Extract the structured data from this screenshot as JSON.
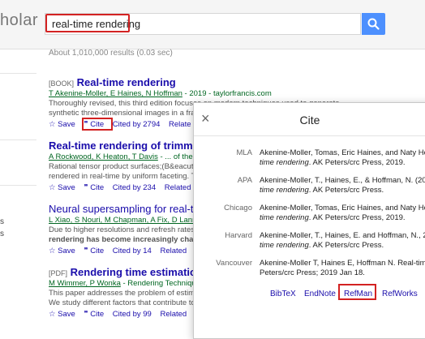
{
  "header": {
    "logo_fragment": "holar",
    "search_value": "real-time rendering"
  },
  "results_summary": "About 1,010,000 results (0.03 sec)",
  "left_panel": {
    "item_1": "s",
    "item_2": "s"
  },
  "results": [
    {
      "tag": "[BOOK]",
      "title": "Real-time rendering",
      "authors_linked": "T Akenine-Moller, E Haines, N Hoffman",
      "authors_rest": " - 2019 - taylorfrancis.com",
      "snippet_1": "Thoroughly revised, this third edition focuses on modern techniques used to generate",
      "snippet_2": "synthetic three-dimensional images in a frac",
      "save": "Save",
      "cite": "Cite",
      "cited_by": "Cited by 2794",
      "related": "Relate"
    },
    {
      "tag": "",
      "title": "Real-time rendering of trimmed s",
      "authors_linked": "A Rockwood, K Heaton, T Davis",
      "authors_rest": " - ... of the 1",
      "snippet_1": "Rational tensor product surfaces;(B&eacute;",
      "snippet_2": "rendered in real-time by uniform faceting. Th",
      "save": "Save",
      "cite": "Cite",
      "cited_by": "Cited by 234",
      "related": "Related"
    },
    {
      "tag": "",
      "title": "Neural supersampling for real-tim",
      "authors_linked": "L Xiao, S Nouri, M Chapman, A Fix, D Lanm",
      "authors_rest": "",
      "snippet_1": "Due to higher resolutions and refresh rates,",
      "snippet_2": "rendering has become increasingly challeng",
      "save": "Save",
      "cite": "Cite",
      "cited_by": "Cited by 14",
      "related": "Related"
    },
    {
      "tag": "[PDF]",
      "title": "Rendering time estimation fo",
      "authors_linked": "M Wimmer, P Wonka",
      "authors_rest": " - Rendering Techniqu",
      "snippet_1": "This paper addresses the problem of estima",
      "snippet_2": "We study different factors that contribute to t",
      "save": "Save",
      "cite": "Cite",
      "cited_by": "Cited by 99",
      "related": "Related"
    }
  ],
  "cite_dialog": {
    "title": "Cite",
    "close": "×",
    "citations": [
      {
        "style": "MLA",
        "line_1": "Akenine-Moller, Tomas, Eric Haines, and Naty Hof",
        "line_2_italic": "time rendering",
        "line_2_rest": ". AK Peters/crc Press, 2019."
      },
      {
        "style": "APA",
        "line_1": "Akenine-Moller, T., Haines, E., & Hoffman, N. (201",
        "line_2_italic": "time rendering",
        "line_2_rest": ". AK Peters/crc Press."
      },
      {
        "style": "Chicago",
        "line_1": "Akenine-Moller, Tomas, Eric Haines, and Naty Hof",
        "line_2_italic": "time rendering",
        "line_2_rest": ". AK Peters/crc Press, 2019."
      },
      {
        "style": "Harvard",
        "line_1": "Akenine-Moller, T., Haines, E. and Hoffman, N., 201",
        "line_2_italic": "time rendering",
        "line_2_rest": ". AK Peters/crc Press."
      },
      {
        "style": "Vancouver",
        "line_1": "Akenine-Moller T, Haines E, Hoffman N. Real-time",
        "line_2_italic": "",
        "line_2_rest": "Peters/crc Press; 2019 Jan 18."
      }
    ],
    "exports": {
      "bibtex": "BibTeX",
      "endnote": "EndNote",
      "refman": "RefMan",
      "refworks": "RefWorks"
    }
  }
}
